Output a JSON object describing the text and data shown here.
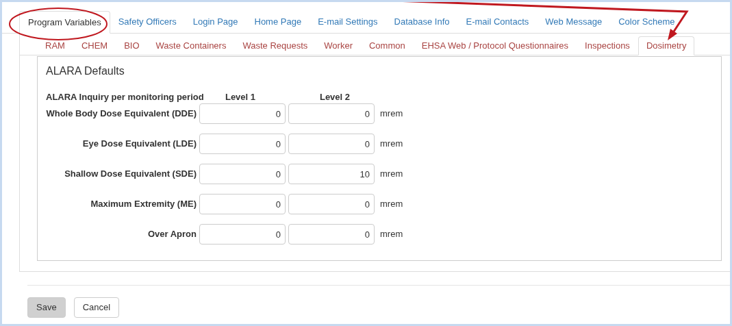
{
  "main_tabs": [
    {
      "label": "Program Variables",
      "selected": true
    },
    {
      "label": "Safety Officers",
      "selected": false
    },
    {
      "label": "Login Page",
      "selected": false
    },
    {
      "label": "Home Page",
      "selected": false
    },
    {
      "label": "E-mail Settings",
      "selected": false
    },
    {
      "label": "Database Info",
      "selected": false
    },
    {
      "label": "E-mail Contacts",
      "selected": false
    },
    {
      "label": "Web Message",
      "selected": false
    },
    {
      "label": "Color Scheme",
      "selected": false
    }
  ],
  "sub_tabs": [
    {
      "label": "RAM",
      "selected": false
    },
    {
      "label": "CHEM",
      "selected": false
    },
    {
      "label": "BIO",
      "selected": false
    },
    {
      "label": "Waste Containers",
      "selected": false
    },
    {
      "label": "Waste Requests",
      "selected": false
    },
    {
      "label": "Worker",
      "selected": false
    },
    {
      "label": "Common",
      "selected": false
    },
    {
      "label": "EHSA Web / Protocol Questionnaires",
      "selected": false
    },
    {
      "label": "Inspections",
      "selected": false
    },
    {
      "label": "Dosimetry",
      "selected": true
    }
  ],
  "section": {
    "title": "ALARA Defaults",
    "header": {
      "label": "ALARA Inquiry per monitoring period",
      "level_1": "Level 1",
      "level_2": "Level 2"
    },
    "rows": [
      {
        "label": "Whole Body Dose Equivalent (DDE)",
        "level_1": "0",
        "level_2": "0",
        "unit": "mrem"
      },
      {
        "label": "Eye Dose Equivalent (LDE)",
        "level_1": "0",
        "level_2": "0",
        "unit": "mrem"
      },
      {
        "label": "Shallow Dose Equivalent (SDE)",
        "level_1": "0",
        "level_2": "10",
        "unit": "mrem"
      },
      {
        "label": "Maximum Extremity (ME)",
        "level_1": "0",
        "level_2": "0",
        "unit": "mrem"
      },
      {
        "label": "Over Apron",
        "level_1": "0",
        "level_2": "0",
        "unit": "mrem"
      }
    ]
  },
  "buttons": [
    {
      "label": "Save",
      "kind": "primary"
    },
    {
      "label": "Cancel",
      "kind": "default"
    }
  ]
}
